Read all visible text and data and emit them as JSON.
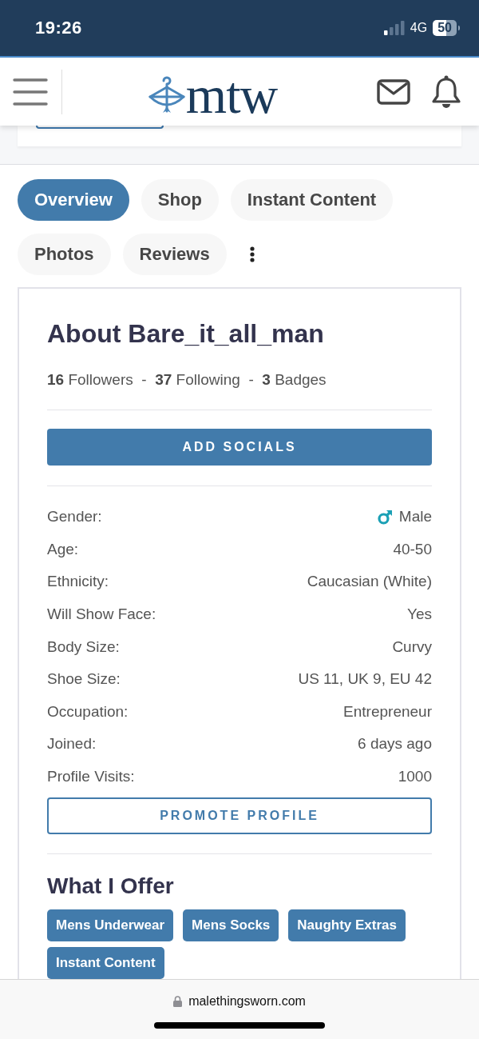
{
  "status_bar": {
    "time": "19:26",
    "network": "4G",
    "battery": "50"
  },
  "header": {
    "logo": "mtw"
  },
  "tabs": [
    {
      "label": "Overview",
      "selected": true
    },
    {
      "label": "Shop",
      "selected": false
    },
    {
      "label": "Instant Content",
      "selected": false
    },
    {
      "label": "Photos",
      "selected": false
    },
    {
      "label": "Reviews",
      "selected": false
    }
  ],
  "profile": {
    "title": "About Bare_it_all_man",
    "stats": "**16** Followers  -  **37** Following  -  **3** Badges",
    "add_socials_button": "ADD SOCIALS",
    "details": [
      {
        "kind": "gender",
        "label": "Gender:",
        "value": "Male"
      },
      {
        "kind": "plain",
        "label": "Age:",
        "value": "40-50"
      },
      {
        "kind": "plain",
        "label": "Ethnicity:",
        "value": "Caucasian (White)"
      },
      {
        "kind": "plain",
        "label": "Will Show Face:",
        "value": "Yes"
      },
      {
        "kind": "plain",
        "label": "Body Size:",
        "value": "Curvy"
      },
      {
        "kind": "plain",
        "label": "Shoe Size:",
        "value": "US 11, UK 9, EU 42"
      },
      {
        "kind": "plain",
        "label": "Occupation:",
        "value": "Entrepreneur"
      },
      {
        "kind": "plain",
        "label": "Joined:",
        "value": "6 days ago"
      },
      {
        "kind": "plain",
        "label": "Profile Visits:",
        "value": "1000"
      }
    ],
    "promote_button": "PROMOTE PROFILE"
  },
  "offers": {
    "title": "What I Offer",
    "tags": [
      "Mens Underwear",
      "Mens Socks",
      "Naughty Extras",
      "Instant Content"
    ]
  },
  "browser_bar": {
    "url": "malethingsworn.com"
  }
}
